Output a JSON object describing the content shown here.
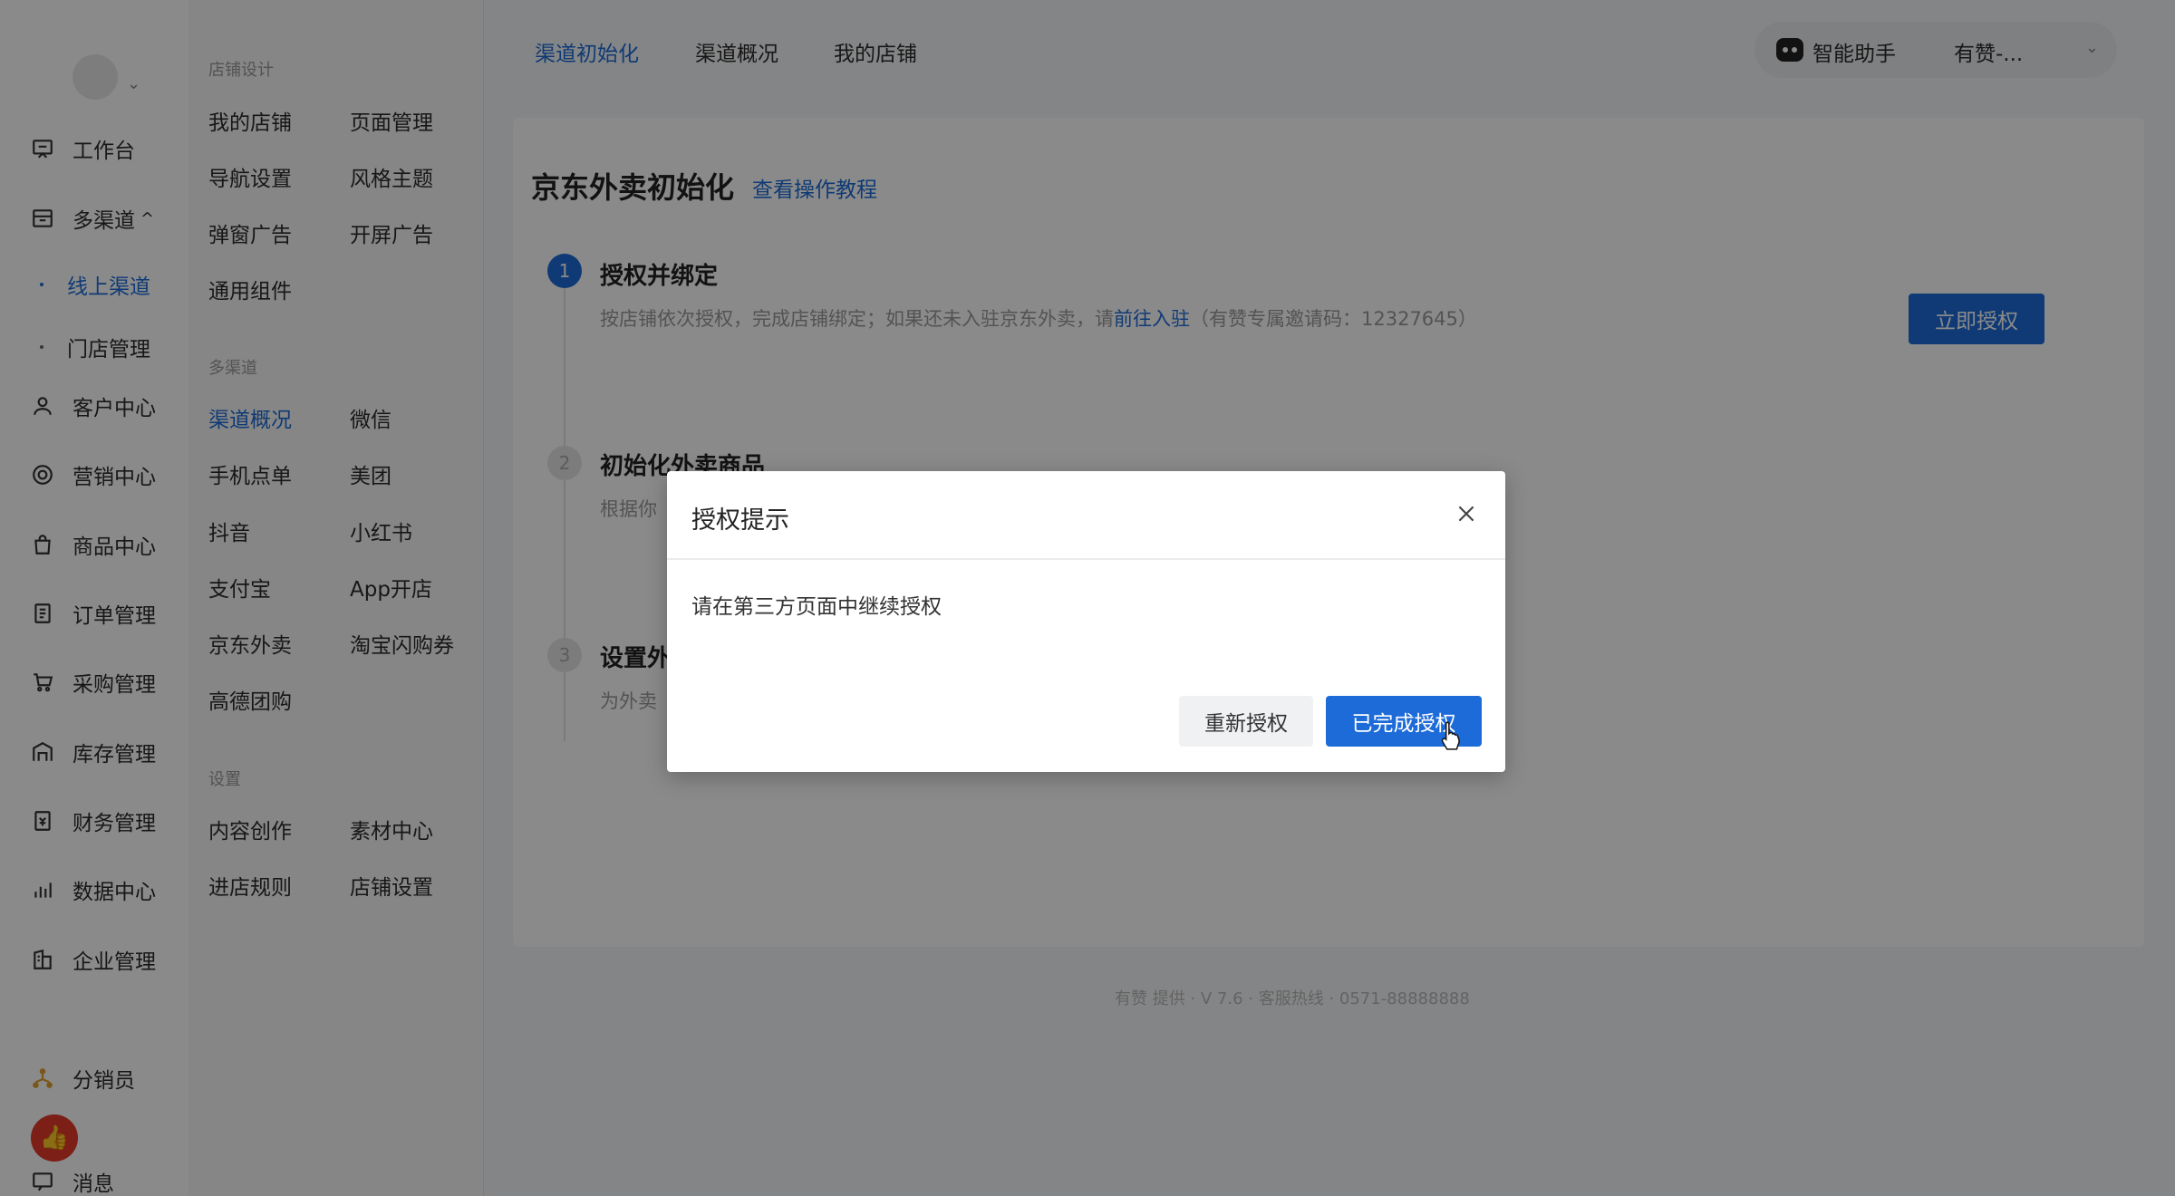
{
  "sidebar": {
    "items": [
      {
        "label": "工作台",
        "icon": "workbench-icon"
      },
      {
        "label": "多渠道",
        "icon": "store-icon",
        "expanded_marker": "^"
      },
      {
        "label": "客户中心",
        "icon": "user-icon"
      },
      {
        "label": "营销中心",
        "icon": "target-icon"
      },
      {
        "label": "商品中心",
        "icon": "bag-icon"
      },
      {
        "label": "订单管理",
        "icon": "order-icon"
      },
      {
        "label": "采购管理",
        "icon": "cart-icon"
      },
      {
        "label": "库存管理",
        "icon": "warehouse-icon"
      },
      {
        "label": "财务管理",
        "icon": "finance-icon"
      },
      {
        "label": "数据中心",
        "icon": "bar-chart-icon"
      },
      {
        "label": "企业管理",
        "icon": "building-icon"
      },
      {
        "label": "分销员",
        "icon": "network-icon"
      },
      {
        "label": "消息",
        "icon": "message-icon"
      }
    ],
    "subitems": [
      {
        "label": "线上渠道",
        "active": true
      },
      {
        "label": "门店管理",
        "active": false
      }
    ]
  },
  "subpanel": {
    "groups": [
      {
        "title": "店铺设计",
        "items": [
          "我的店铺",
          "页面管理",
          "导航设置",
          "风格主题",
          "弹窗广告",
          "开屏广告",
          "通用组件"
        ]
      },
      {
        "title": "多渠道",
        "items": [
          "渠道概况",
          "微信",
          "手机点单",
          "美团",
          "抖音",
          "小红书",
          "支付宝",
          "App开店",
          "京东外卖",
          "淘宝闪购券",
          "高德团购"
        ]
      },
      {
        "title": "设置",
        "items": [
          "内容创作",
          "素材中心",
          "进店规则",
          "店铺设置"
        ]
      }
    ],
    "active_item": "渠道概况"
  },
  "topbar": {
    "tabs": [
      "渠道初始化",
      "渠道概况",
      "我的店铺"
    ],
    "active_tab": "渠道初始化",
    "assistant_label": "智能助手",
    "store_name": "有赞-..."
  },
  "main": {
    "title": "京东外卖初始化",
    "tutorial_link": "查看操作教程",
    "authorize_button": "立即授权",
    "steps": [
      {
        "number": "1",
        "title": "授权并绑定",
        "desc_prefix": "按店铺依次授权，完成店铺绑定；如果还未入驻京东外卖，请",
        "desc_link": "前往入驻",
        "desc_suffix": "（有赞专属邀请码：12327645）"
      },
      {
        "number": "2",
        "title": "初始化外卖商品",
        "desc": "根据你"
      },
      {
        "number": "3",
        "title": "设置外",
        "desc": "为外卖"
      }
    ]
  },
  "footer": {
    "text": "有赞 提供 · V 7.6 · 客服热线 · 0571-88888888"
  },
  "modal": {
    "title": "授权提示",
    "body": "请在第三方页面中继续授权",
    "secondary_button": "重新授权",
    "primary_button": "已完成授权"
  },
  "colors": {
    "accent": "#1d6bd8",
    "like": "#e53b2c"
  }
}
